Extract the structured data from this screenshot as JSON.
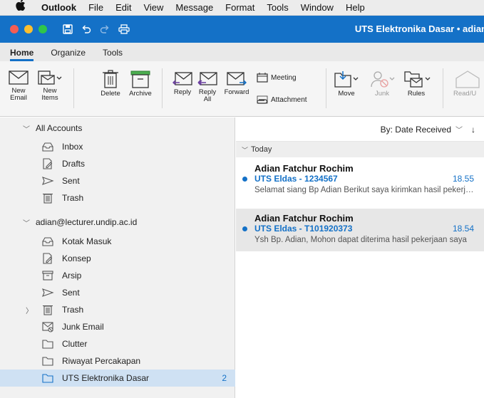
{
  "menubar": {
    "items": [
      "Outlook",
      "File",
      "Edit",
      "View",
      "Message",
      "Format",
      "Tools",
      "Window",
      "Help"
    ]
  },
  "window": {
    "title": "UTS Elektronika Dasar • adian"
  },
  "ribbon_tabs": [
    "Home",
    "Organize",
    "Tools"
  ],
  "ribbon": {
    "new_email": [
      "New",
      "Email"
    ],
    "new_items": [
      "New",
      "Items"
    ],
    "delete": "Delete",
    "archive": "Archive",
    "reply": "Reply",
    "reply_all": [
      "Reply",
      "All"
    ],
    "forward": "Forward",
    "meeting": "Meeting",
    "attachment": "Attachment",
    "move": "Move",
    "junk": "Junk",
    "rules": "Rules",
    "read_unread": "Read/U"
  },
  "folders": {
    "all_accounts": "All Accounts",
    "group1": [
      "Inbox",
      "Drafts",
      "Sent",
      "Trash"
    ],
    "account": "adian@lecturer.undip.ac.id",
    "group2": [
      "Kotak Masuk",
      "Konsep",
      "Arsip",
      "Sent",
      "Trash",
      "Junk Email",
      "Clutter",
      "Riwayat Percakapan",
      "UTS Elektronika Dasar"
    ],
    "selected_count": "2"
  },
  "message_list": {
    "sort_label": "By: Date Received",
    "group": "Today",
    "messages": [
      {
        "from": "Adian Fatchur Rochim",
        "subject": "UTS Eldas - 1234567",
        "time": "18.55",
        "preview": "Selamat siang Bp Adian Berikut saya kirimkan hasil pekerjaan saya"
      },
      {
        "from": "Adian Fatchur Rochim",
        "subject": "UTS Eldas - T101920373",
        "time": "18.54",
        "preview": "Ysh Bp. Adian, Mohon dapat diterima hasil pekerjaan saya"
      }
    ]
  },
  "colors": {
    "accent": "#1471c7",
    "selected_folder": "#cfe1f3"
  }
}
